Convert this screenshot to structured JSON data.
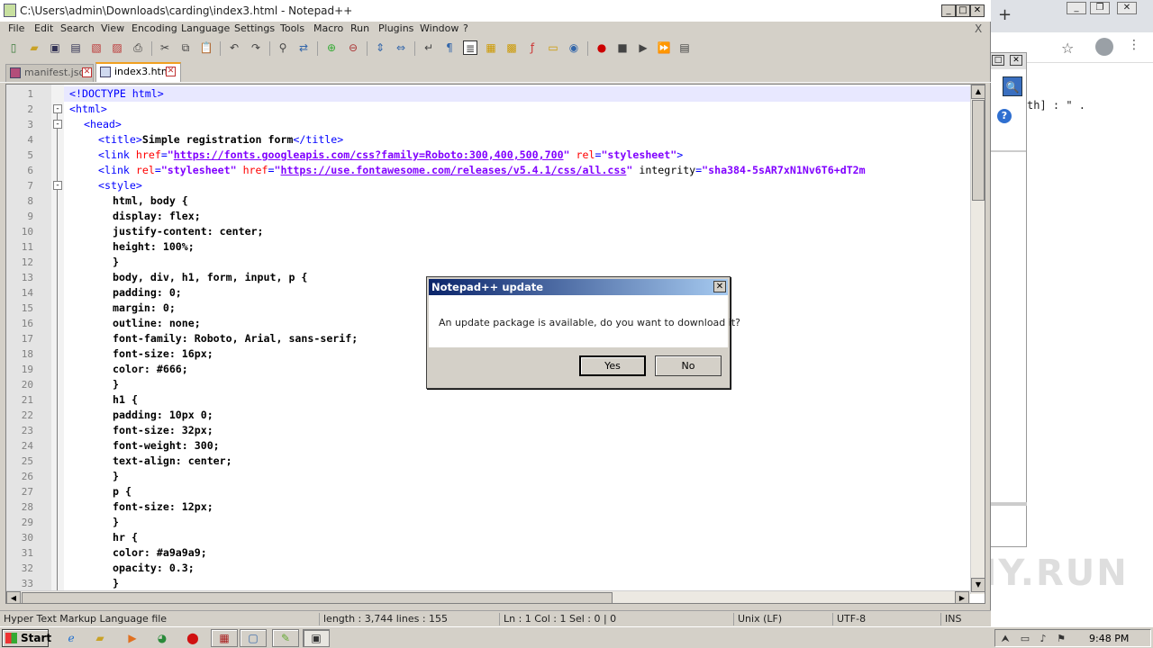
{
  "window": {
    "title": "C:\\Users\\admin\\Downloads\\carding\\index3.html - Notepad++",
    "minimize": "_",
    "maximize": "□",
    "close": "✕"
  },
  "menu": [
    "File",
    "Edit",
    "Search",
    "View",
    "Encoding",
    "Language",
    "Settings",
    "Tools",
    "Macro",
    "Run",
    "Plugins",
    "Window",
    "?"
  ],
  "menu_close": "X",
  "tabs": [
    {
      "label": "manifest.json",
      "active": false
    },
    {
      "label": "index3.html",
      "active": true
    }
  ],
  "editor": {
    "lines": [
      {
        "n": "1",
        "indent": 0,
        "fold": "",
        "html": "<span class=\"tag\">&lt;!DOCTYPE html&gt;</span>"
      },
      {
        "n": "2",
        "indent": 0,
        "fold": "-",
        "html": "<span class=\"tag\">&lt;html&gt;</span>"
      },
      {
        "n": "3",
        "indent": 1,
        "fold": "-",
        "html": "<span class=\"tag\">&lt;head&gt;</span>"
      },
      {
        "n": "4",
        "indent": 2,
        "fold": "",
        "html": "<span class=\"tag\">&lt;title&gt;</span><span class=\"txt\">Simple registration form</span><span class=\"tag\">&lt;/title&gt;</span>"
      },
      {
        "n": "5",
        "indent": 2,
        "fold": "",
        "html": "<span class=\"tag\">&lt;link </span><span class=\"attr\">href</span><span class=\"tag\">=</span><span class=\"str\">\"</span><span class=\"url\">https://fonts.googleapis.com/css?family=Roboto:300,400,500,700</span><span class=\"str\">\"</span> <span class=\"attr\">rel</span><span class=\"tag\">=</span><span class=\"str\">\"stylesheet\"</span><span class=\"tag\">&gt;</span>"
      },
      {
        "n": "6",
        "indent": 2,
        "fold": "",
        "html": "<span class=\"tag\">&lt;link </span><span class=\"attr\">rel</span><span class=\"tag\">=</span><span class=\"str\">\"stylesheet\"</span> <span class=\"attr\">href</span><span class=\"tag\">=</span><span class=\"str\">\"</span><span class=\"url\">https://use.fontawesome.com/releases/v5.4.1/css/all.css</span><span class=\"str\">\"</span> <span class=\"plainattr\">integrity</span><span class=\"tag\">=</span><span class=\"str\">\"sha384-5sAR7xN1Nv6T6+dT2m</span>"
      },
      {
        "n": "7",
        "indent": 2,
        "fold": "-",
        "html": "<span class=\"tag\">&lt;style&gt;</span>"
      },
      {
        "n": "8",
        "indent": 3,
        "fold": "",
        "html": "<span class=\"txt\">html, body {</span>"
      },
      {
        "n": "9",
        "indent": 3,
        "fold": "",
        "html": "<span class=\"txt\">display: flex;</span>"
      },
      {
        "n": "10",
        "indent": 3,
        "fold": "",
        "html": "<span class=\"txt\">justify-content: center;</span>"
      },
      {
        "n": "11",
        "indent": 3,
        "fold": "",
        "html": "<span class=\"txt\">height: 100%;</span>"
      },
      {
        "n": "12",
        "indent": 3,
        "fold": "",
        "html": "<span class=\"txt\">}</span>"
      },
      {
        "n": "13",
        "indent": 3,
        "fold": "",
        "html": "<span class=\"txt\">body, div, h1, form, input, p {</span>"
      },
      {
        "n": "14",
        "indent": 3,
        "fold": "",
        "html": "<span class=\"txt\">padding: 0;</span>"
      },
      {
        "n": "15",
        "indent": 3,
        "fold": "",
        "html": "<span class=\"txt\">margin: 0;</span>"
      },
      {
        "n": "16",
        "indent": 3,
        "fold": "",
        "html": "<span class=\"txt\">outline: none;</span>"
      },
      {
        "n": "17",
        "indent": 3,
        "fold": "",
        "html": "<span class=\"txt\">font-family: Roboto, Arial, sans-serif;</span>"
      },
      {
        "n": "18",
        "indent": 3,
        "fold": "",
        "html": "<span class=\"txt\">font-size: 16px;</span>"
      },
      {
        "n": "19",
        "indent": 3,
        "fold": "",
        "html": "<span class=\"txt\">color: #666;</span>"
      },
      {
        "n": "20",
        "indent": 3,
        "fold": "",
        "html": "<span class=\"txt\">}</span>"
      },
      {
        "n": "21",
        "indent": 3,
        "fold": "",
        "html": "<span class=\"txt\">h1 {</span>"
      },
      {
        "n": "22",
        "indent": 3,
        "fold": "",
        "html": "<span class=\"txt\">padding: 10px 0;</span>"
      },
      {
        "n": "23",
        "indent": 3,
        "fold": "",
        "html": "<span class=\"txt\">font-size: 32px;</span>"
      },
      {
        "n": "24",
        "indent": 3,
        "fold": "",
        "html": "<span class=\"txt\">font-weight: 300;</span>"
      },
      {
        "n": "25",
        "indent": 3,
        "fold": "",
        "html": "<span class=\"txt\">text-align: center;</span>"
      },
      {
        "n": "26",
        "indent": 3,
        "fold": "",
        "html": "<span class=\"txt\">}</span>"
      },
      {
        "n": "27",
        "indent": 3,
        "fold": "",
        "html": "<span class=\"txt\">p {</span>"
      },
      {
        "n": "28",
        "indent": 3,
        "fold": "",
        "html": "<span class=\"txt\">font-size: 12px;</span>"
      },
      {
        "n": "29",
        "indent": 3,
        "fold": "",
        "html": "<span class=\"txt\">}</span>"
      },
      {
        "n": "30",
        "indent": 3,
        "fold": "",
        "html": "<span class=\"txt\">hr {</span>"
      },
      {
        "n": "31",
        "indent": 3,
        "fold": "",
        "html": "<span class=\"txt\">color: #a9a9a9;</span>"
      },
      {
        "n": "32",
        "indent": 3,
        "fold": "",
        "html": "<span class=\"txt\">opacity: 0.3;</span>"
      },
      {
        "n": "33",
        "indent": 3,
        "fold": "",
        "html": "<span class=\"txt\">}</span>"
      }
    ]
  },
  "statusbar": {
    "filetype": "Hyper Text Markup Language file",
    "length": "length : 3,744    lines : 155",
    "position": "Ln : 1    Col : 1    Sel : 0 | 0",
    "eol": "Unix (LF)",
    "encoding": "UTF-8",
    "mode": "INS"
  },
  "dialog": {
    "title": "Notepad++ update",
    "message": "An update package is available, do you want to download it?",
    "yes": "Yes",
    "no": "No",
    "close": "✕"
  },
  "browser": {
    "new_tab": "+",
    "code_fragment": "th] : \" .",
    "search_glyph": "🔍",
    "help_glyph": "?"
  },
  "watermark": "ANY.RUN",
  "taskbar": {
    "start": "Start",
    "clock": "9:48 PM"
  }
}
